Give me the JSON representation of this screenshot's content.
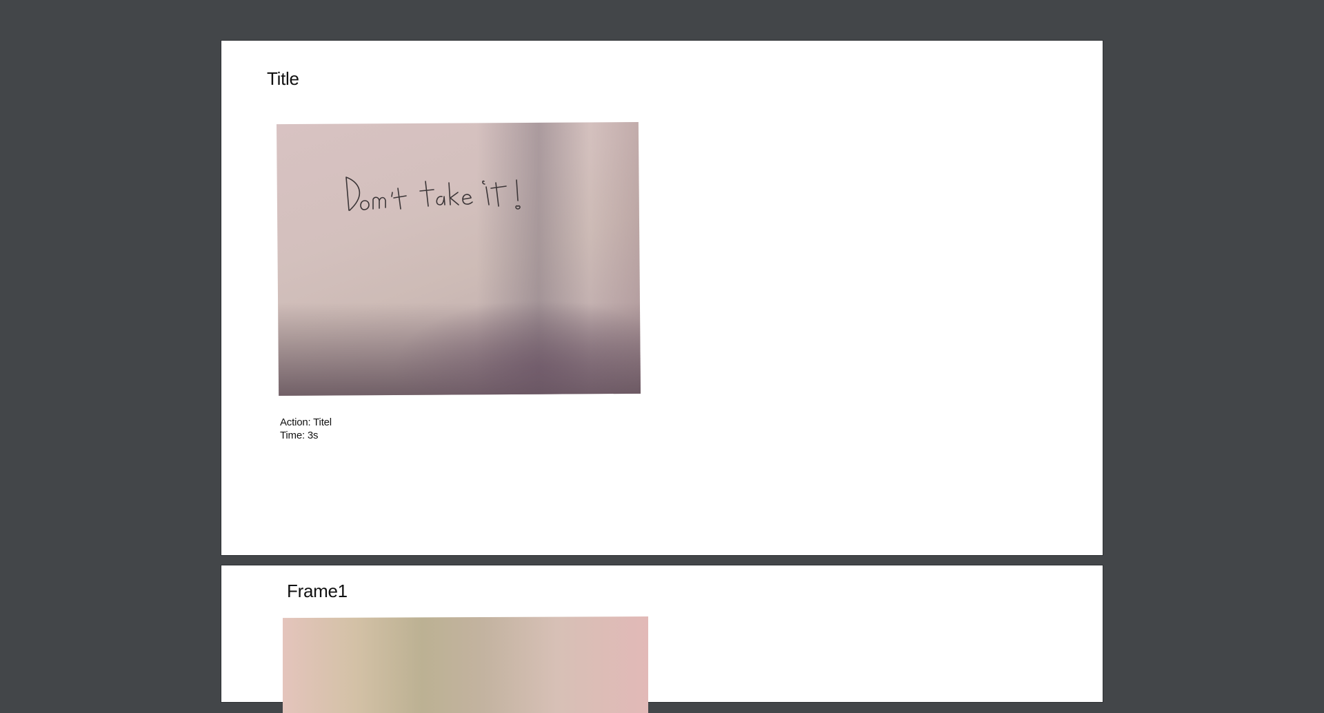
{
  "pages": [
    {
      "title": "Title",
      "photo": {
        "description_text": "Don't take it!"
      },
      "action_text": "Action: Titel",
      "time_text": "Time: 3s"
    },
    {
      "title": "Frame1"
    }
  ],
  "colors": {
    "viewer_background": "#434649",
    "page_background": "#ffffff"
  }
}
